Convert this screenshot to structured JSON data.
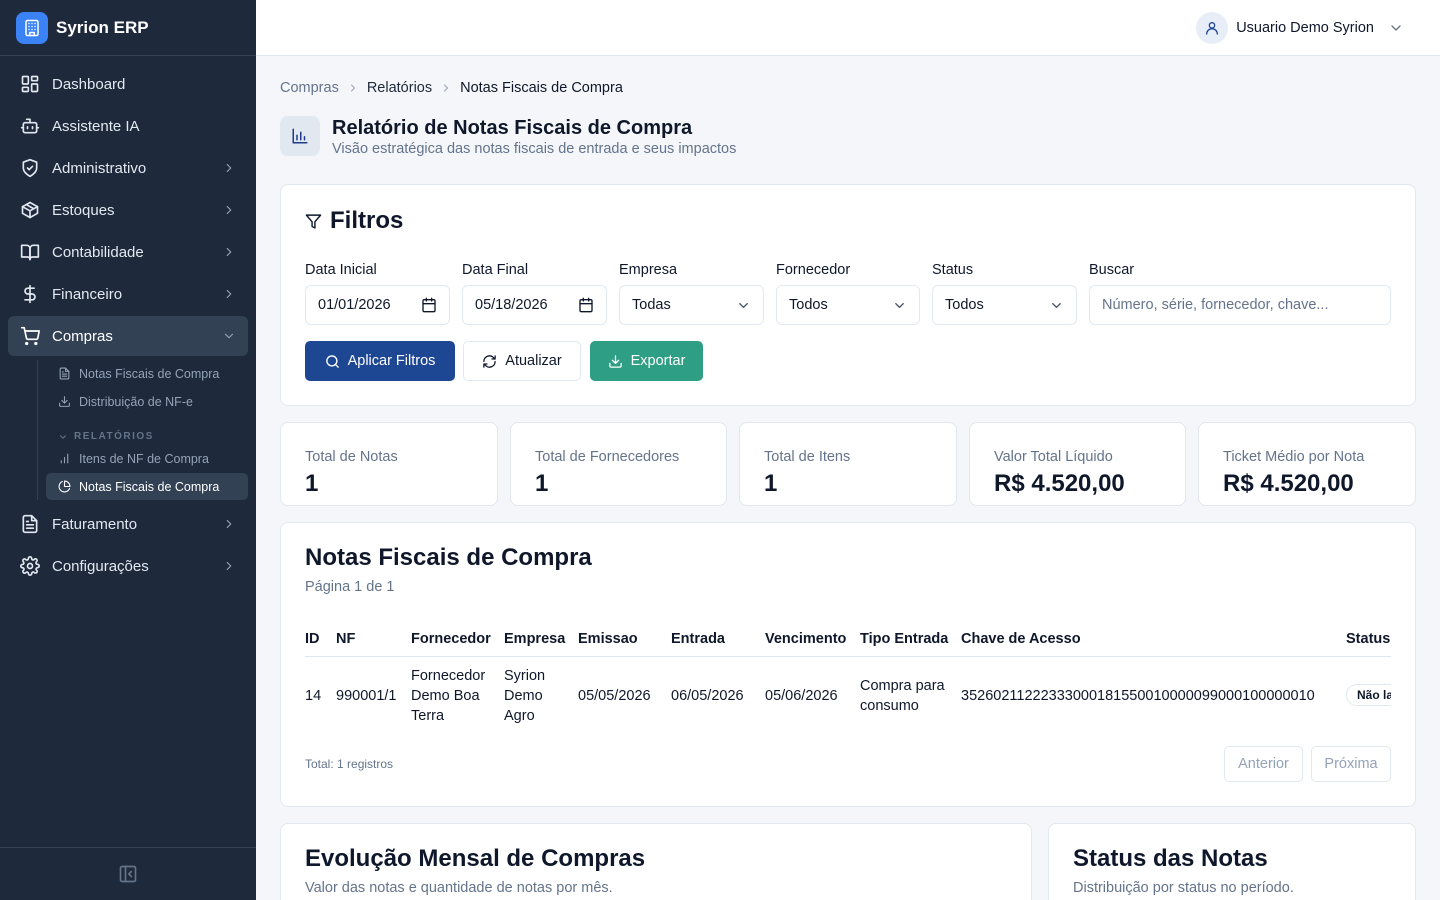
{
  "brand": {
    "name": "Syrion ERP"
  },
  "sidebar": {
    "items": [
      {
        "label": "Dashboard"
      },
      {
        "label": "Assistente IA"
      },
      {
        "label": "Administrativo"
      },
      {
        "label": "Estoques"
      },
      {
        "label": "Contabilidade"
      },
      {
        "label": "Financeiro"
      },
      {
        "label": "Compras"
      },
      {
        "label": "Faturamento"
      },
      {
        "label": "Configurações"
      }
    ],
    "compras_sub": [
      {
        "label": "Notas Fiscais de Compra"
      },
      {
        "label": "Distribuição de NF-e"
      }
    ],
    "relatorios_label": "RELATÓRIOS",
    "relatorios_sub": [
      {
        "label": "Itens de NF de Compra"
      },
      {
        "label": "Notas Fiscais de Compra"
      }
    ]
  },
  "header": {
    "user_name": "Usuario Demo Syrion"
  },
  "breadcrumb": [
    "Compras",
    "Relatórios",
    "Notas Fiscais de Compra"
  ],
  "page": {
    "title": "Relatório de Notas Fiscais de Compra",
    "subtitle": "Visão estratégica das notas fiscais de entrada e seus impactos"
  },
  "filters": {
    "title": "Filtros",
    "data_inicial": {
      "label": "Data Inicial",
      "value": "01/01/2026"
    },
    "data_final": {
      "label": "Data Final",
      "value": "05/18/2026"
    },
    "empresa": {
      "label": "Empresa",
      "value": "Todas"
    },
    "fornecedor": {
      "label": "Fornecedor",
      "value": "Todos"
    },
    "status": {
      "label": "Status",
      "value": "Todos"
    },
    "buscar": {
      "label": "Buscar",
      "placeholder": "Número, série, fornecedor, chave..."
    },
    "apply_label": "Aplicar Filtros",
    "refresh_label": "Atualizar",
    "export_label": "Exportar"
  },
  "stats": [
    {
      "label": "Total de Notas",
      "value": "1"
    },
    {
      "label": "Total de Fornecedores",
      "value": "1"
    },
    {
      "label": "Total de Itens",
      "value": "1"
    },
    {
      "label": "Valor Total Líquido",
      "value": "R$ 4.520,00"
    },
    {
      "label": "Ticket Médio por Nota",
      "value": "R$ 4.520,00"
    }
  ],
  "table": {
    "title": "Notas Fiscais de Compra",
    "subtitle": "Página 1 de 1",
    "columns": [
      "ID",
      "NF",
      "Fornecedor",
      "Empresa",
      "Emissao",
      "Entrada",
      "Vencimento",
      "Tipo Entrada",
      "Chave de Acesso",
      "Status"
    ],
    "rows": [
      {
        "id": "14",
        "nf": "990001/1",
        "fornecedor": "Fornecedor Demo Boa Terra",
        "empresa": "Syrion Demo Agro",
        "emissao": "05/05/2026",
        "entrada": "06/05/2026",
        "vencimento": "05/06/2026",
        "tipo_entrada": "Compra para consumo",
        "chave": "35260211222333000181550010000099000100000010",
        "status": "Não lançada"
      }
    ],
    "total_label": "Total: 1 registros",
    "prev_label": "Anterior",
    "next_label": "Próxima"
  },
  "monthly": {
    "title": "Evolução Mensal de Compras",
    "subtitle": "Valor das notas e quantidade de notas por mês."
  },
  "status_card": {
    "title": "Status das Notas",
    "subtitle": "Distribuição por status no período."
  }
}
